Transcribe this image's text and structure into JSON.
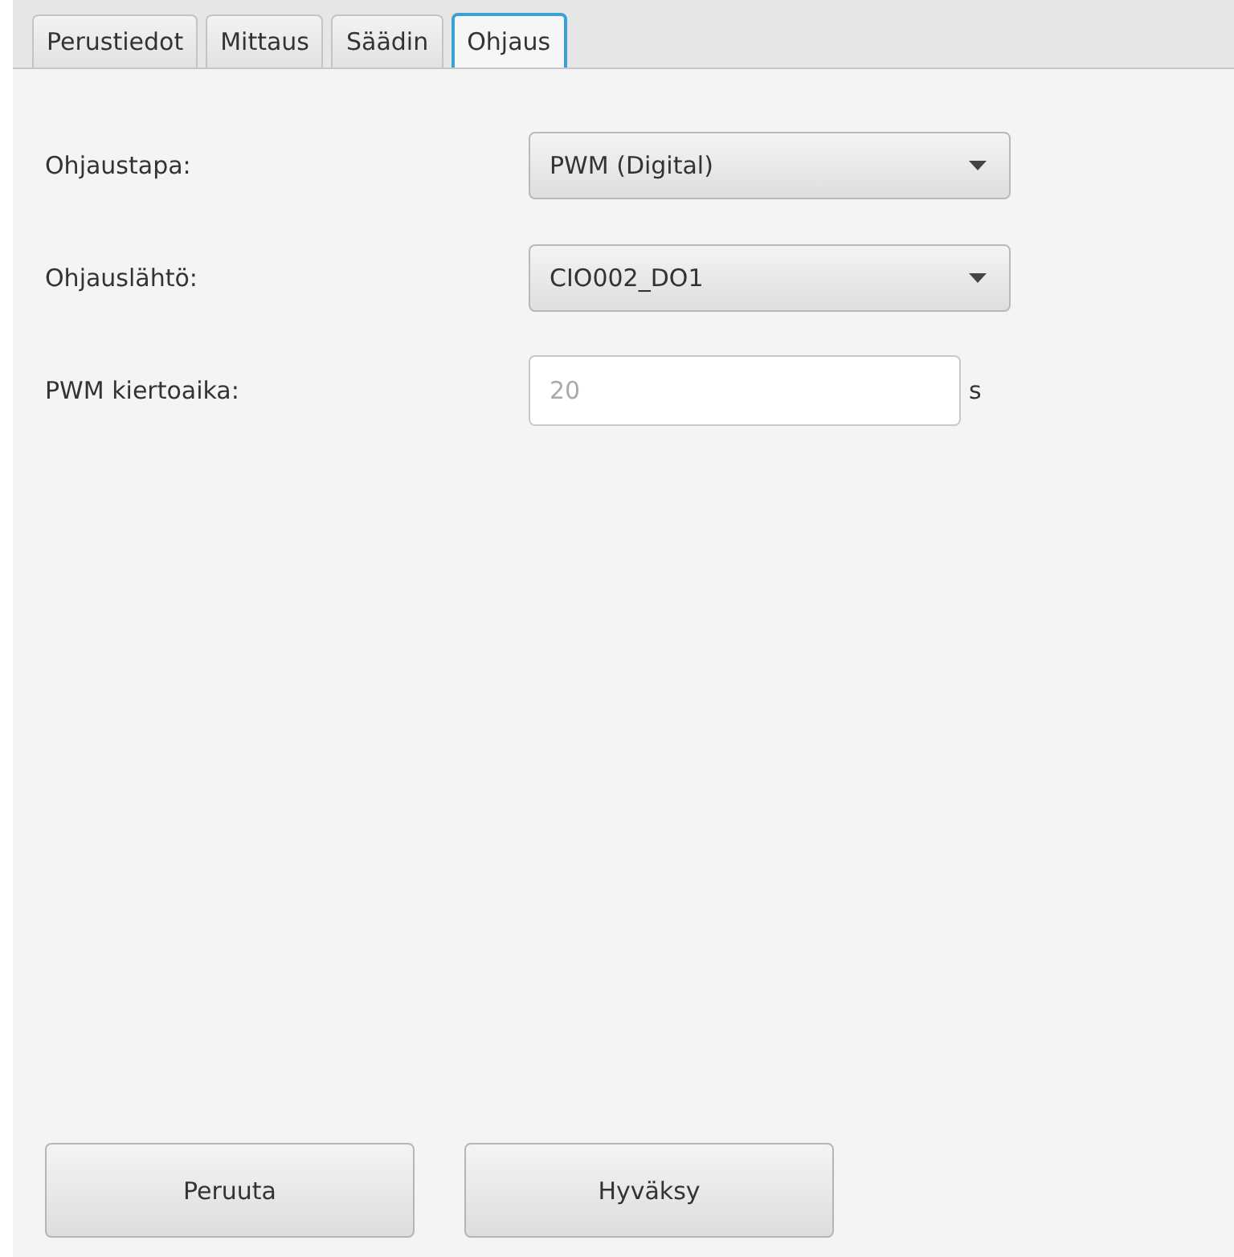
{
  "tabs": [
    {
      "label": "Perustiedot",
      "selected": false
    },
    {
      "label": "Mittaus",
      "selected": false
    },
    {
      "label": "Säädin",
      "selected": false
    },
    {
      "label": "Ohjaus",
      "selected": true
    }
  ],
  "fields": [
    {
      "kind": "combo",
      "label": "Ohjaustapa:",
      "value": "PWM (Digital)"
    },
    {
      "kind": "combo",
      "label": "Ohjauslähtö:",
      "value": "CIO002_DO1"
    },
    {
      "kind": "text",
      "label": "PWM kiertoaika:",
      "placeholder": "20",
      "unit": "s"
    }
  ],
  "buttons": [
    "Peruuta",
    "Hyväksy"
  ]
}
